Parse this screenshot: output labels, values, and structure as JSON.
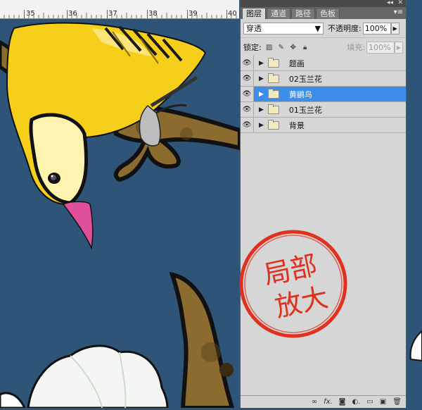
{
  "ruler": {
    "numbers": [
      "35",
      "36",
      "37",
      "38",
      "39",
      "40"
    ]
  },
  "panel": {
    "tabs": [
      {
        "label": "图层",
        "active": true
      },
      {
        "label": "通道",
        "active": false
      },
      {
        "label": "路径",
        "active": false
      },
      {
        "label": "色板",
        "active": false
      }
    ],
    "blend_mode": "穿透",
    "opacity_label": "不透明度:",
    "opacity_value": "100%",
    "lock_label": "锁定:",
    "fill_label": "填充:",
    "fill_value": "100%",
    "layers": [
      {
        "name": "题画",
        "selected": false
      },
      {
        "name": "02玉兰花",
        "selected": false
      },
      {
        "name": "黄鹂鸟",
        "selected": true
      },
      {
        "name": "01玉兰花",
        "selected": false
      },
      {
        "name": "背景",
        "selected": false
      }
    ],
    "bottom_icons": [
      "link-icon",
      "fx-icon",
      "mask-icon",
      "adjustment-icon",
      "group-icon",
      "new-layer-icon",
      "trash-icon"
    ],
    "selected_color": "#3d8ee8"
  },
  "stamp": {
    "line1": "局部",
    "line2": "放大",
    "color": "#e0301e"
  },
  "canvas": {
    "background": "#2e5578"
  }
}
